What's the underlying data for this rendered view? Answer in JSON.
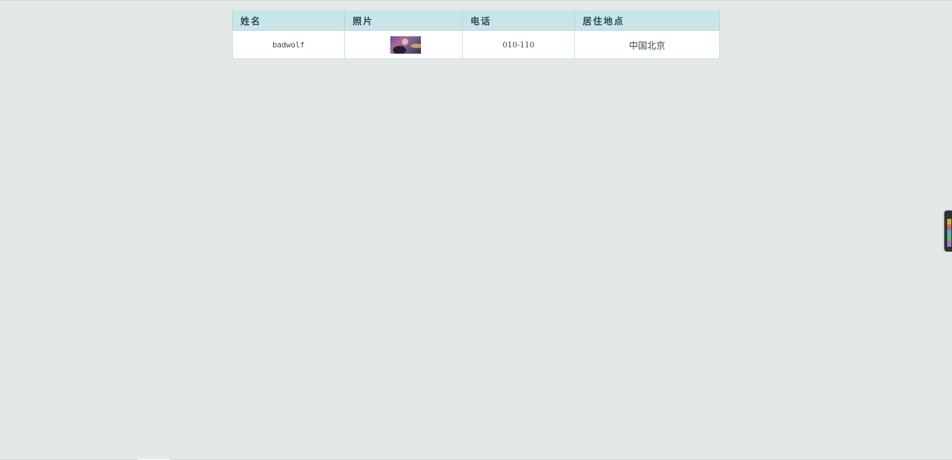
{
  "table": {
    "headers": [
      "姓名",
      "照片",
      "电话",
      "居住地点"
    ],
    "rows": [
      {
        "name": "badwolf",
        "photo": "portrait-thumbnail",
        "phone": "010-110",
        "location": "中国北京"
      }
    ]
  },
  "icons": {
    "side_widget": "music-player-tab-icon"
  },
  "colors": {
    "page_background": "#e4e9e7",
    "header_background": "#c8e6e9",
    "row_background": "#ffffff"
  }
}
